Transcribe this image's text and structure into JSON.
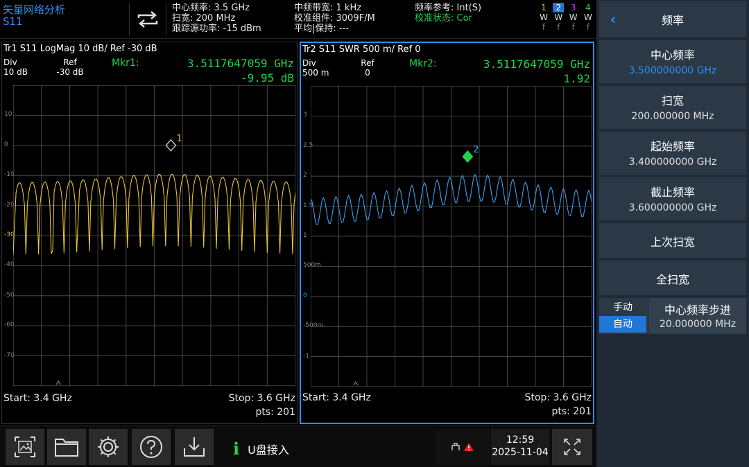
{
  "app": {
    "title": "矢量网络分析",
    "measurement": "S11"
  },
  "status": {
    "center_freq": "中心频率: 3.5 GHz",
    "span": "扫宽: 200 MHz",
    "source_power": "跟踪源功率: -15 dBm",
    "if_bw": "中频带宽: 1 kHz",
    "cal_kit": "校准组件: 3009F/M",
    "avg_hold": "平均|保持: ---",
    "freq_ref": "频率参考: Int(S)",
    "cal_state": "校准状态: Cor"
  },
  "channels": {
    "numbers": [
      "1",
      "2",
      "3",
      "4"
    ],
    "w_row": [
      "W",
      "W",
      "W",
      "W"
    ],
    "f_row": [
      "f",
      "f",
      "f",
      "f"
    ],
    "colors": [
      "#f0c419",
      "#1f78d8",
      "#c040e0",
      "#20d34a"
    ]
  },
  "trace1": {
    "header": "Tr1 S11 LogMag 10 dB/ Ref -30 dB",
    "div_label": "Div",
    "div_value": "10 dB",
    "ref_label": "Ref",
    "ref_value": "-30 dB",
    "marker_label": "Mkr1:",
    "marker_freq": "3.5117647059 GHz",
    "marker_value": "-9.95 dB",
    "marker_num": "1",
    "y_ticks": [
      "10",
      "0",
      "-10",
      "-20",
      "-30",
      "-40",
      "-50",
      "-60",
      "-70"
    ],
    "start": "Start: 3.4 GHz",
    "stop": "Stop: 3.6 GHz",
    "points": "pts: 201",
    "color": "#e8c433"
  },
  "trace2": {
    "header": "Tr2 S11 SWR 500 m/ Ref 0",
    "div_label": "Div",
    "div_value": "500 m",
    "ref_label": "Ref",
    "ref_value": "0",
    "marker_label": "Mkr2:",
    "marker_freq": "3.5117647059 GHz",
    "marker_value": "1.92",
    "marker_num": "2",
    "y_ticks": [
      "3",
      "2.5",
      "2",
      "1.5",
      "1",
      "500m",
      "0",
      "-500m",
      "-1"
    ],
    "start": "Start: 3.4 GHz",
    "stop": "Stop: 3.6 GHz",
    "points": "pts: 201",
    "color": "#3aa0f0"
  },
  "menu": {
    "title": "频率",
    "center_freq_label": "中心频率",
    "center_freq_value": "3.500000000 GHz",
    "span_label": "扫宽",
    "span_value": "200.000000 MHz",
    "start_label": "起始频率",
    "start_value": "3.400000000 GHz",
    "stop_label": "截止频率",
    "stop_value": "3.600000000 GHz",
    "last_span": "上次扫宽",
    "full_span": "全扫宽",
    "step_manual": "手动",
    "step_auto": "自动",
    "step_label": "中心频率步进",
    "step_value": "20.000000 MHz"
  },
  "toolbar": {
    "usb_message": "U盘接入",
    "time": "12:59",
    "date": "2025-11-04"
  }
}
